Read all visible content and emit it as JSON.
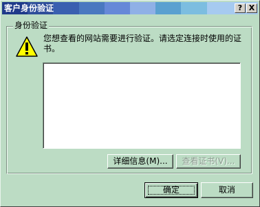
{
  "window": {
    "title": "客户身份验证",
    "help_label": "?",
    "close_label": "X"
  },
  "group": {
    "label": "身份验证"
  },
  "message": "您想查看的网站需要进行验证。请选定连接时使用的证书。",
  "certificate_list": [],
  "buttons": {
    "details": "详细信息(M)...",
    "view_certificate": "查看证书(V)...",
    "ok": "确定",
    "cancel": "取消"
  },
  "icons": {
    "warning": "warning-icon"
  },
  "colors": {
    "dialog_background": "#bcdcc4",
    "titlebar_start": "#0a246a",
    "warning_fill": "#ffff00"
  }
}
